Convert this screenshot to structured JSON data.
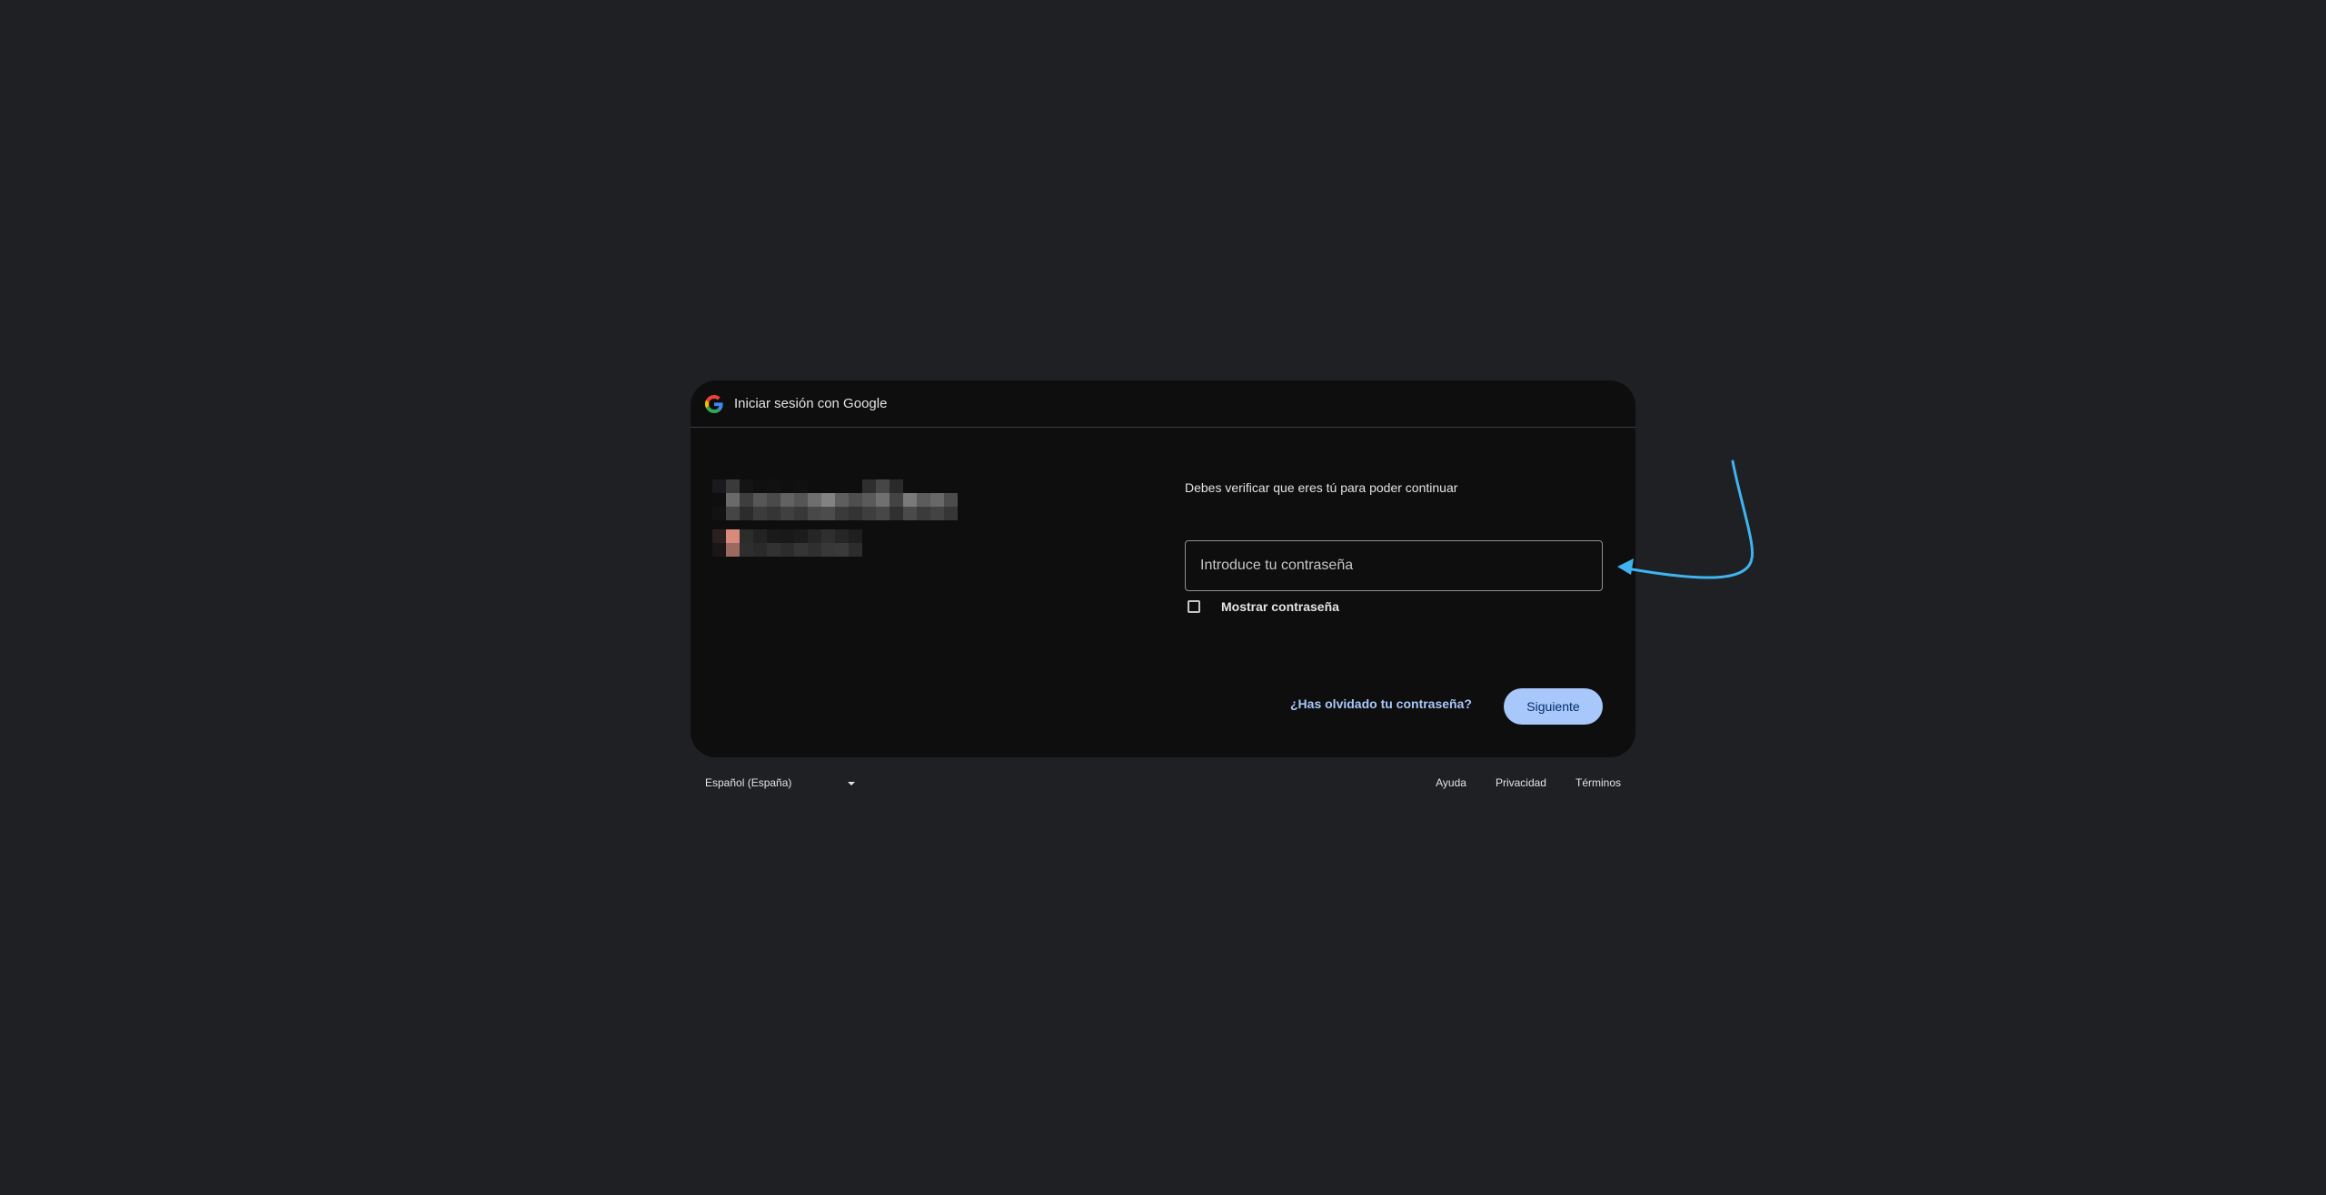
{
  "header": {
    "title": "Iniciar sesión con Google",
    "logo_icon": "google-g-icon"
  },
  "main": {
    "verify_text": "Debes verificar que eres tú para poder continuar",
    "password_placeholder": "Introduce tu contraseña",
    "show_password_label": "Mostrar contraseña",
    "show_password_checked": false,
    "forgot_password_label": "¿Has olvidado tu contraseña?",
    "next_label": "Siguiente"
  },
  "footer": {
    "language": "Español (España)",
    "links": [
      "Ayuda",
      "Privacidad",
      "Términos"
    ]
  },
  "colors": {
    "page_bg": "#1f2023",
    "card_bg": "#0e0e0e",
    "accent": "#a8c7fa",
    "annotation_arrow": "#3fb4f0"
  }
}
